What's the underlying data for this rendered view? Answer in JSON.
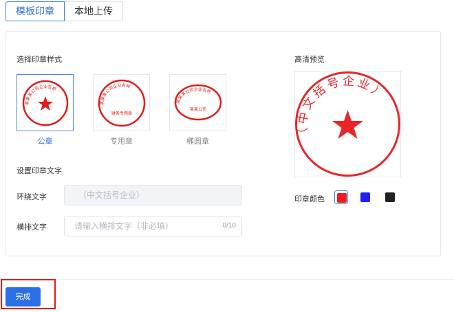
{
  "tabs": [
    {
      "label": "模板印章",
      "active": true
    },
    {
      "label": "本地上传",
      "active": false
    }
  ],
  "style_section": {
    "title": "选择印章样式",
    "options": [
      {
        "label": "公章",
        "selected": true,
        "seal_text": "某某某公司企业名称",
        "center_text": ""
      },
      {
        "label": "专用章",
        "selected": false,
        "seal_text": "某某某公司企业名称",
        "center_text": "财务专用章"
      },
      {
        "label": "椭圆章",
        "selected": false,
        "seal_text": "某某某公司企业名称",
        "center_text": "某某公司"
      }
    ]
  },
  "text_section": {
    "title": "设置印章文字",
    "ring_label": "环绕文字",
    "ring_value": "（中文括号企业）",
    "horizontal_label": "横排文字",
    "horizontal_placeholder": "请输入横排文字（非必填）",
    "horizontal_counter": "0/10"
  },
  "preview": {
    "title": "高清预览",
    "seal_text": "（中文括号企业）",
    "seal_color": "#e8262a"
  },
  "color_section": {
    "label": "印章颜色",
    "colors": [
      {
        "name": "red",
        "hex": "#ee1c1c",
        "selected": true
      },
      {
        "name": "blue",
        "hex": "#2121f0",
        "selected": false
      },
      {
        "name": "black",
        "hex": "#222222",
        "selected": false
      }
    ]
  },
  "footer": {
    "done_label": "完成"
  }
}
